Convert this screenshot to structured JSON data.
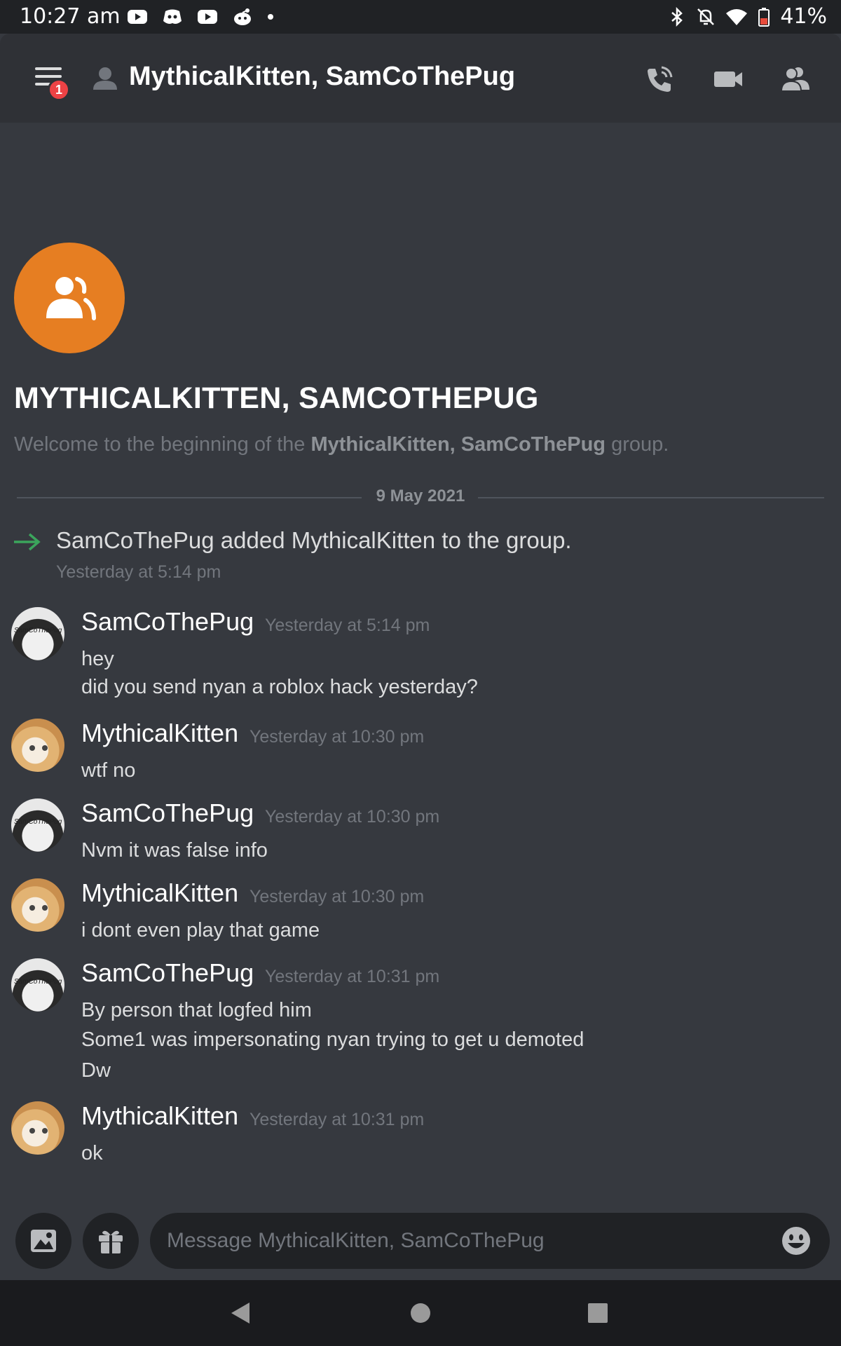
{
  "status_bar": {
    "time": "10:27 am",
    "battery": "41%",
    "notification_icons": [
      "youtube-icon",
      "discord-icon",
      "youtube-icon",
      "reddit-icon",
      "dot-icon"
    ],
    "system_icons": [
      "bluetooth-icon",
      "bell-off-icon",
      "wifi-icon",
      "battery-icon"
    ]
  },
  "header": {
    "menu_badge": "1",
    "title": "MythicalKitten, SamCoThePug",
    "actions": [
      "phone-icon",
      "video-icon",
      "members-icon"
    ]
  },
  "intro": {
    "group_name": "MYTHICALKITTEN, SAMCOTHEPUG",
    "welcome_prefix": "Welcome to the beginning of the ",
    "welcome_name": "MythicalKitten, SamCoThePug",
    "welcome_suffix": " group."
  },
  "divider": {
    "date": "9 May 2021"
  },
  "system_message": {
    "text": "SamCoThePug added MythicalKitten to the group.",
    "time": "Yesterday at 5:14 pm"
  },
  "messages": [
    {
      "author": "SamCoThePug",
      "avatar": "sam",
      "time": "Yesterday at 5:14 pm",
      "lines": [
        "hey",
        "did you send nyan a roblox hack yesterday?"
      ]
    },
    {
      "author": "MythicalKitten",
      "avatar": "kitten",
      "time": "Yesterday at 10:30 pm",
      "lines": [
        "wtf no"
      ]
    },
    {
      "author": "SamCoThePug",
      "avatar": "sam",
      "time": "Yesterday at 10:30 pm",
      "lines": [
        "Nvm it was false info"
      ]
    },
    {
      "author": "MythicalKitten",
      "avatar": "kitten",
      "time": "Yesterday at 10:30 pm",
      "lines": [
        "i dont even play that game"
      ]
    },
    {
      "author": "SamCoThePug",
      "avatar": "sam",
      "time": "Yesterday at 10:31 pm",
      "lines": [
        "By person that logfed him",
        "Some1 was impersonating nyan trying to get u demoted",
        "Dw"
      ]
    },
    {
      "author": "MythicalKitten",
      "avatar": "kitten",
      "time": "Yesterday at 10:31 pm",
      "lines": [
        "ok"
      ]
    }
  ],
  "avatar_caption": "SamCoThePug",
  "composer": {
    "placeholder": "Message MythicalKitten, SamCoThePug",
    "value": ""
  },
  "colors": {
    "background": "#36393f",
    "header": "#2f3136",
    "group_avatar": "#e67e22",
    "badge": "#ed4245",
    "system_arrow": "#3ba55c"
  }
}
